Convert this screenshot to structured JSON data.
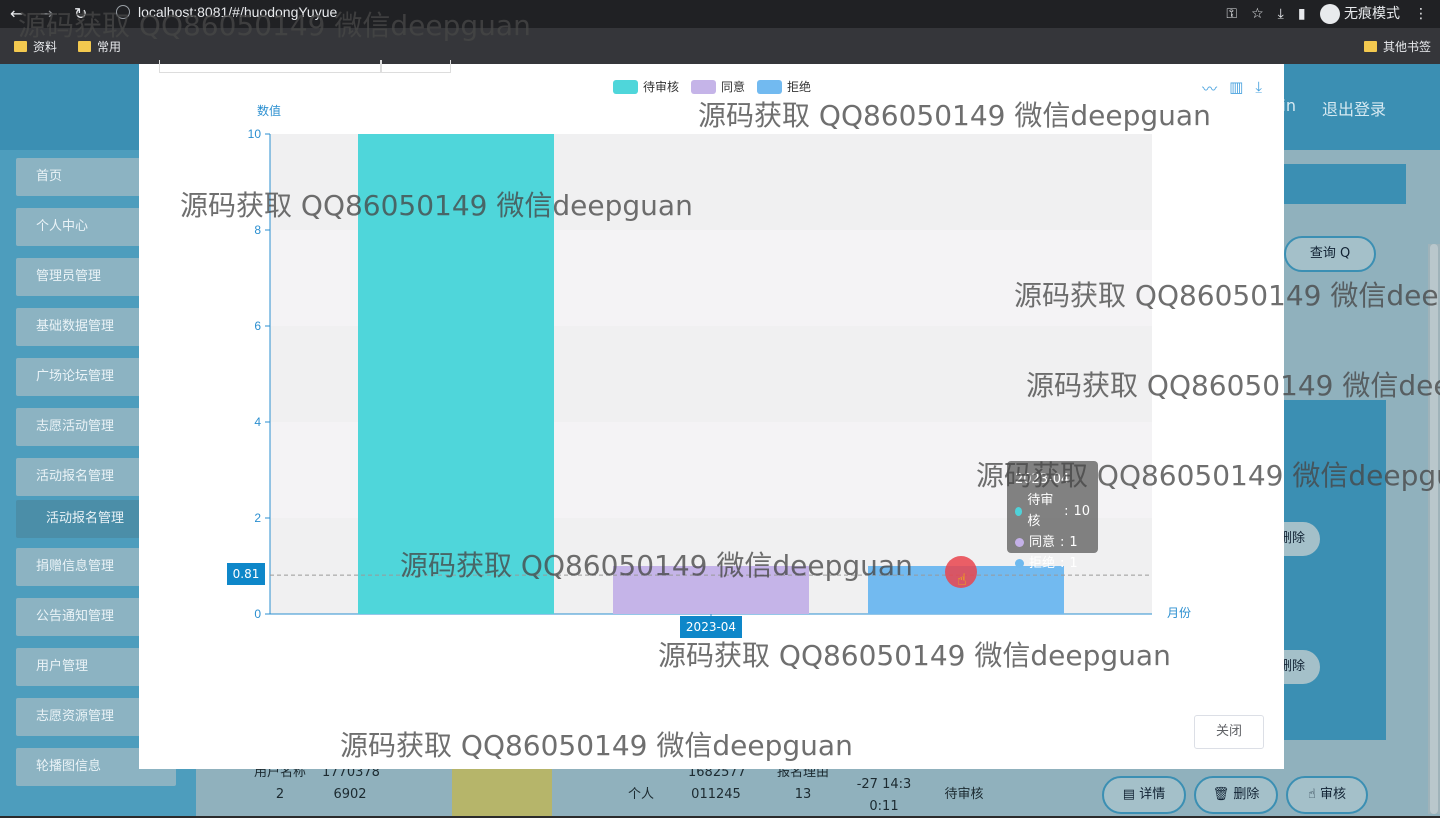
{
  "browser": {
    "url": "localhost:8081/#/huodongYuyue",
    "incognito_label": "无痕模式",
    "bookmarks": [
      "资料",
      "常用"
    ],
    "other_bookmarks": "其他书签"
  },
  "app": {
    "header_user": "min",
    "logout": "退出登录",
    "sidebar": [
      "首页",
      "个人中心",
      "管理员管理",
      "基础数据管理",
      "广场论坛管理",
      "志愿活动管理",
      "活动报名管理",
      "活动报名管理",
      "捐赠信息管理",
      "公告通知管理",
      "用户管理",
      "志愿资源管理",
      "轮播图信息"
    ],
    "query_button": "查询 Q",
    "row_actions": {
      "detail": "详情",
      "delete": "删除",
      "audit": "审核"
    },
    "delete_short": "删除",
    "table_row": {
      "user_name": "用户名称 2",
      "phone": "1770378 6902",
      "type": "个人",
      "number": "1682577 011245",
      "reason": "报名理由 13",
      "time": "2023-04 -27 14:3 0:11",
      "status": "待审核"
    }
  },
  "modal": {
    "close_button": "关闭",
    "tooltip": {
      "title": "2023-04",
      "items": [
        {
          "name": "待审核",
          "value": "10",
          "color": "#4fd2d9"
        },
        {
          "name": "同意",
          "value": "1",
          "color": "#c4b1e8"
        },
        {
          "name": "拒绝",
          "value": "1",
          "color": "#6fb9ee"
        }
      ]
    },
    "pointer_y_label": "0.81",
    "pointer_x_label": "2023-04"
  },
  "chart_data": {
    "type": "bar",
    "categories": [
      "2023-04"
    ],
    "series": [
      {
        "name": "待审核",
        "values": [
          10
        ],
        "color": "#4fd6da"
      },
      {
        "name": "同意",
        "values": [
          1
        ],
        "color": "#c5b4e8"
      },
      {
        "name": "拒绝",
        "values": [
          1
        ],
        "color": "#72baf0"
      }
    ],
    "ylabel": "数值",
    "xlabel": "月份",
    "ylim": [
      0,
      10
    ],
    "yticks": [
      0,
      2,
      4,
      6,
      8,
      10
    ],
    "legend_position": "top-center",
    "grid": true
  },
  "watermark": "源码获取 QQ86050149 微信deepguan"
}
